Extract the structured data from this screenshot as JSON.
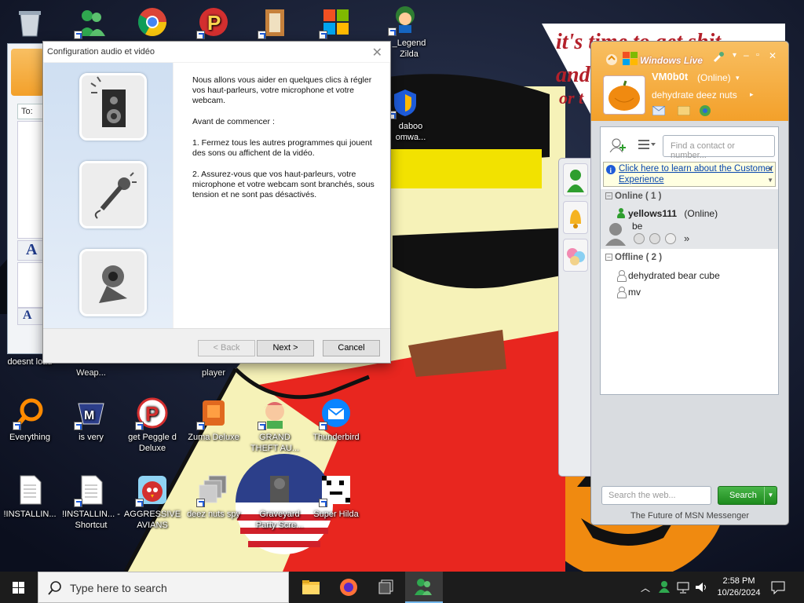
{
  "wallpaper": {
    "caption_line1": "it's time to get shit",
    "caption_line2": "and",
    "caption_line3": "or t"
  },
  "desktop_icons": [
    {
      "label": "",
      "icon": "recycle-bin-icon"
    },
    {
      "label": "",
      "icon": "msn-buddies-icon"
    },
    {
      "label": "",
      "icon": "chrome-icon"
    },
    {
      "label": "",
      "icon": "peggle-icon"
    },
    {
      "label": "",
      "icon": "book-icon"
    },
    {
      "label": "",
      "icon": "windows-shield-icon"
    },
    {
      "label": "_Legend Zilda",
      "icon": "zelda-character-icon"
    },
    {
      "label": "daboo omwa...",
      "icon": "shield-icon"
    },
    {
      "label": "doesnt load",
      "icon": "app-icon"
    },
    {
      "label": "Weap...",
      "icon": "app-icon"
    },
    {
      "label": "player",
      "icon": "app-icon"
    },
    {
      "label": "Everything",
      "icon": "everything-search-icon"
    },
    {
      "label": "is very",
      "icon": "game-icon"
    },
    {
      "label": "get Peggle d Deluxe",
      "icon": "peggle-icon"
    },
    {
      "label": "Zuma Deluxe",
      "icon": "zuma-icon"
    },
    {
      "label": "GRAND THEFT AU...",
      "icon": "anime-girl-icon"
    },
    {
      "label": "Thunderbird",
      "icon": "thunderbird-icon"
    },
    {
      "label": "!INSTALLIN...",
      "icon": "text-file-icon"
    },
    {
      "label": "!INSTALLIN... - Shortcut",
      "icon": "text-file-icon"
    },
    {
      "label": "AGGRESSIVE AVIANS",
      "icon": "angry-bird-icon"
    },
    {
      "label": "deez nuts spy",
      "icon": "windows-stack-icon"
    },
    {
      "label": "Graveyard Party Scre...",
      "icon": "voted-sticker-icon"
    },
    {
      "label": "Super Hilda",
      "icon": "pixel-character-icon"
    }
  ],
  "dialog": {
    "title": "Configuration audio et vidéo",
    "paragraphs": [
      "Nous allons vous aider en quelques clics à régler vos haut-parleurs, votre microphone et votre webcam.",
      "Avant de commencer :",
      "1. Fermez tous les autres programmes qui jouent des sons ou affichent de la vidéo.",
      "2. Assurez-vous que vos haut-parleurs, votre microphone et votre webcam sont branchés, sous tension et ne sont pas désactivés."
    ],
    "buttons": {
      "back": "< Back",
      "next": "Next >",
      "cancel": "Cancel"
    }
  },
  "messenger": {
    "brand": "Windows Live",
    "user": {
      "name": "VM0b0t",
      "status": "(Online)",
      "personal_message": "dehydrate deez nuts"
    },
    "search_contacts_placeholder": "Find a contact or number...",
    "notice": "Click here to learn about the Customer Experience",
    "groups": {
      "online": "Online ( 1 )",
      "offline": "Offline ( 2 )"
    },
    "contacts_online": [
      {
        "name": "yellows111",
        "status": "(Online)",
        "message": "be"
      }
    ],
    "contacts_offline": [
      {
        "name": "dehydrated bear cube"
      },
      {
        "name": "mv"
      }
    ],
    "web_search_placeholder": "Search the web...",
    "search_button": "Search",
    "footer": "The Future of MSN Messenger",
    "more": "»"
  },
  "background_conversation": {
    "to_label": "To:",
    "font_letter": "A"
  },
  "taskbar": {
    "search_placeholder": "Type here to search",
    "time": "2:58 PM",
    "date": "10/26/2024"
  },
  "colors": {
    "msn_orange": "#f3a02a",
    "search_green": "#2e9e2e",
    "taskbar": "#1c1c1c",
    "link_blue": "#0645ad"
  }
}
